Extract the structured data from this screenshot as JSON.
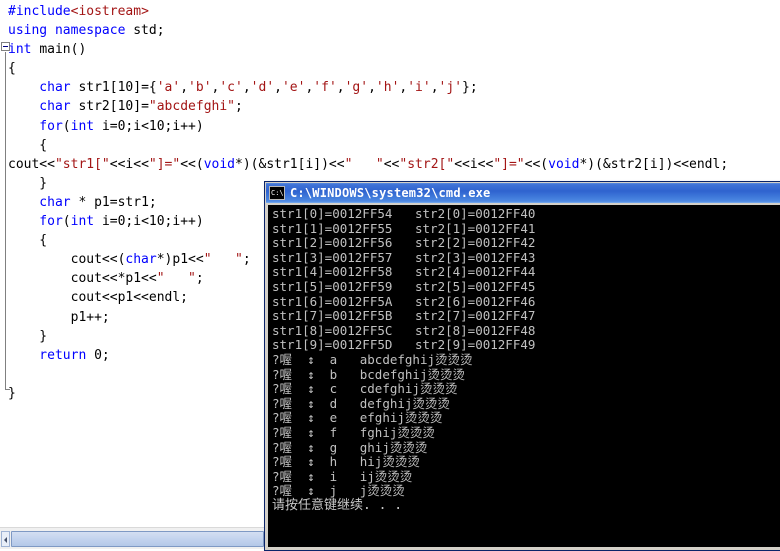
{
  "editor": {
    "name": "code-editor",
    "language": "cpp",
    "code_lines": [
      [
        {
          "t": "#include",
          "c": "pp"
        },
        {
          "t": "<iostream>",
          "c": "ppinc"
        }
      ],
      [
        {
          "t": "using namespace ",
          "c": "kw"
        },
        {
          "t": "std;",
          "c": "pl"
        }
      ],
      [
        {
          "t": "int ",
          "c": "kw"
        },
        {
          "t": "main()",
          "c": "pl"
        }
      ],
      [
        {
          "t": "{",
          "c": "pl"
        }
      ],
      [
        {
          "t": "    char ",
          "c": "kw"
        },
        {
          "t": "str1[10]={",
          "c": "pl"
        },
        {
          "t": "'a'",
          "c": "str"
        },
        {
          "t": ",",
          "c": "pl"
        },
        {
          "t": "'b'",
          "c": "str"
        },
        {
          "t": ",",
          "c": "pl"
        },
        {
          "t": "'c'",
          "c": "str"
        },
        {
          "t": ",",
          "c": "pl"
        },
        {
          "t": "'d'",
          "c": "str"
        },
        {
          "t": ",",
          "c": "pl"
        },
        {
          "t": "'e'",
          "c": "str"
        },
        {
          "t": ",",
          "c": "pl"
        },
        {
          "t": "'f'",
          "c": "str"
        },
        {
          "t": ",",
          "c": "pl"
        },
        {
          "t": "'g'",
          "c": "str"
        },
        {
          "t": ",",
          "c": "pl"
        },
        {
          "t": "'h'",
          "c": "str"
        },
        {
          "t": ",",
          "c": "pl"
        },
        {
          "t": "'i'",
          "c": "str"
        },
        {
          "t": ",",
          "c": "pl"
        },
        {
          "t": "'j'",
          "c": "str"
        },
        {
          "t": "};",
          "c": "pl"
        }
      ],
      [
        {
          "t": "    char ",
          "c": "kw"
        },
        {
          "t": "str2[10]=",
          "c": "pl"
        },
        {
          "t": "\"abcdefghi\"",
          "c": "str"
        },
        {
          "t": ";",
          "c": "pl"
        }
      ],
      [
        {
          "t": "    for",
          "c": "kw"
        },
        {
          "t": "(",
          "c": "pl"
        },
        {
          "t": "int ",
          "c": "kw"
        },
        {
          "t": "i=0;i<10;i++)",
          "c": "pl"
        }
      ],
      [
        {
          "t": "    {",
          "c": "pl"
        }
      ],
      [
        {
          "t": "cout<<",
          "c": "pl"
        },
        {
          "t": "\"str1[\"",
          "c": "str"
        },
        {
          "t": "<<i<<",
          "c": "pl"
        },
        {
          "t": "\"]=\"",
          "c": "str"
        },
        {
          "t": "<<(",
          "c": "pl"
        },
        {
          "t": "void",
          "c": "kw"
        },
        {
          "t": "*)(&str1[i])<<",
          "c": "pl"
        },
        {
          "t": "\"   \"",
          "c": "str"
        },
        {
          "t": "<<",
          "c": "pl"
        },
        {
          "t": "\"str2[\"",
          "c": "str"
        },
        {
          "t": "<<i<<",
          "c": "pl"
        },
        {
          "t": "\"]=\"",
          "c": "str"
        },
        {
          "t": "<<(",
          "c": "pl"
        },
        {
          "t": "void",
          "c": "kw"
        },
        {
          "t": "*)(&str2[i])<<endl;",
          "c": "pl"
        }
      ],
      [
        {
          "t": "    }",
          "c": "pl"
        }
      ],
      [
        {
          "t": "    char ",
          "c": "kw"
        },
        {
          "t": "* p1=str1;",
          "c": "pl"
        }
      ],
      [
        {
          "t": "    for",
          "c": "kw"
        },
        {
          "t": "(",
          "c": "pl"
        },
        {
          "t": "int ",
          "c": "kw"
        },
        {
          "t": "i=0;i<10;i++)",
          "c": "pl"
        }
      ],
      [
        {
          "t": "    {",
          "c": "pl"
        }
      ],
      [
        {
          "t": "        cout<<(",
          "c": "pl"
        },
        {
          "t": "char",
          "c": "kw"
        },
        {
          "t": "*)p1<<",
          "c": "pl"
        },
        {
          "t": "\"   \"",
          "c": "str"
        },
        {
          "t": ";",
          "c": "pl"
        }
      ],
      [
        {
          "t": "        cout<<*p1<<",
          "c": "pl"
        },
        {
          "t": "\"   \"",
          "c": "str"
        },
        {
          "t": ";",
          "c": "pl"
        }
      ],
      [
        {
          "t": "        cout<<p1<<endl;",
          "c": "pl"
        }
      ],
      [
        {
          "t": "        p1++;",
          "c": "pl"
        }
      ],
      [
        {
          "t": "    }",
          "c": "pl"
        }
      ],
      [
        {
          "t": "    return ",
          "c": "kw"
        },
        {
          "t": "0;",
          "c": "pl"
        }
      ],
      [],
      [
        {
          "t": "}",
          "c": "pl"
        }
      ]
    ]
  },
  "console": {
    "title": "C:\\WINDOWS\\system32\\cmd.exe",
    "icon_label": "C:\\",
    "output_lines": [
      "str1[0]=0012FF54   str2[0]=0012FF40",
      "str1[1]=0012FF55   str2[1]=0012FF41",
      "str1[2]=0012FF56   str2[2]=0012FF42",
      "str1[3]=0012FF57   str2[3]=0012FF43",
      "str1[4]=0012FF58   str2[4]=0012FF44",
      "str1[5]=0012FF59   str2[5]=0012FF45",
      "str1[6]=0012FF5A   str2[6]=0012FF46",
      "str1[7]=0012FF5B   str2[7]=0012FF47",
      "str1[8]=0012FF5C   str2[8]=0012FF48",
      "str1[9]=0012FF5D   str2[9]=0012FF49",
      "?喔  ↕  a   abcdefghij烫烫烫",
      "?喔  ↕  b   bcdefghij烫烫烫",
      "?喔  ↕  c   cdefghij烫烫烫",
      "?喔  ↕  d   defghij烫烫烫",
      "?喔  ↕  e   efghij烫烫烫",
      "?喔  ↕  f   fghij烫烫烫",
      "?喔  ↕  g   ghij烫烫烫",
      "?喔  ↕  h   hij烫烫烫",
      "?喔  ↕  i   ij烫烫烫",
      "?喔  ↕  j   j烫烫烫"
    ],
    "prompt_line": "请按任意键继续. . ."
  },
  "scrollbar": {
    "name": "horizontal-scrollbar"
  },
  "colors": {
    "keyword": "#0000ff",
    "string": "#a31515",
    "console_bg": "#000000",
    "console_fg": "#c0c0c0",
    "titlebar": "#2f63cf"
  }
}
